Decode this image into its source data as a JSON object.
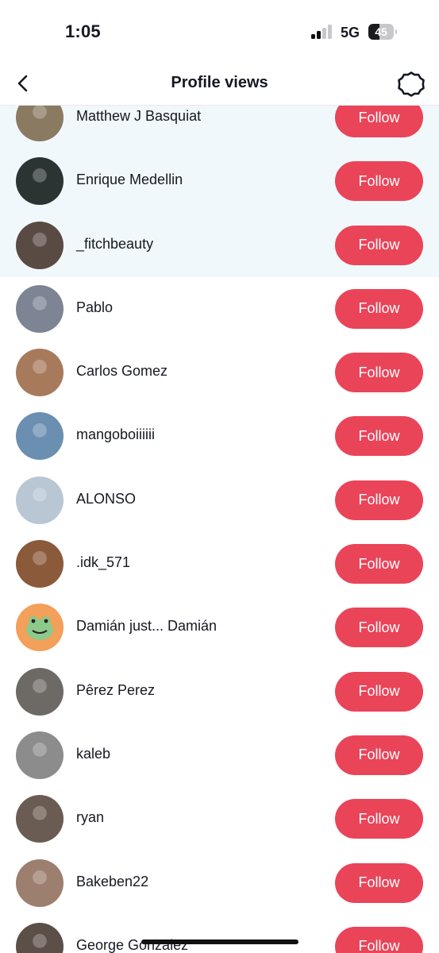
{
  "status_bar": {
    "time": "1:05",
    "network": "5G",
    "battery": "45",
    "battery_level_percent": 45,
    "signal_bars_active": 2
  },
  "nav": {
    "title": "Profile views",
    "back_icon": "chevron-left-icon",
    "settings_icon": "gear-icon"
  },
  "colors": {
    "follow_button": "#ea4459",
    "highlight_row": "#f1f8fb"
  },
  "viewers": [
    {
      "name": "Matthew J Basquiat",
      "button": "Follow",
      "highlight": true,
      "avatar_bg": "#8a7a62"
    },
    {
      "name": "Enrique Medellin",
      "button": "Follow",
      "highlight": true,
      "avatar_bg": "#2c3333"
    },
    {
      "name": "_fitchbeauty",
      "button": "Follow",
      "highlight": true,
      "avatar_bg": "#5a4a44"
    },
    {
      "name": "Pablo",
      "button": "Follow",
      "highlight": false,
      "avatar_bg": "#7d8594"
    },
    {
      "name": "Carlos Gomez",
      "button": "Follow",
      "highlight": false,
      "avatar_bg": "#a87a5c"
    },
    {
      "name": "mangoboiiiiii",
      "button": "Follow",
      "highlight": false,
      "avatar_bg": "#6b8fb0"
    },
    {
      "name": "ALONSO",
      "button": "Follow",
      "highlight": false,
      "avatar_bg": "#b9c6d4"
    },
    {
      "name": ".idk_571",
      "button": "Follow",
      "highlight": false,
      "avatar_bg": "#8a5a3a"
    },
    {
      "name": "Damián just... Damián",
      "button": "Follow",
      "highlight": false,
      "avatar_bg": "#f2a05a"
    },
    {
      "name": "Pêrez Perez",
      "button": "Follow",
      "highlight": false,
      "avatar_bg": "#6d6a66"
    },
    {
      "name": "kaleb",
      "button": "Follow",
      "highlight": false,
      "avatar_bg": "#8c8c8c"
    },
    {
      "name": "ryan",
      "button": "Follow",
      "highlight": false,
      "avatar_bg": "#6a5c52"
    },
    {
      "name": "Bakeben22",
      "button": "Follow",
      "highlight": false,
      "avatar_bg": "#9c7f6e"
    },
    {
      "name": "George Gonzalez",
      "button": "Follow",
      "highlight": false,
      "avatar_bg": "#5c4f48"
    }
  ]
}
